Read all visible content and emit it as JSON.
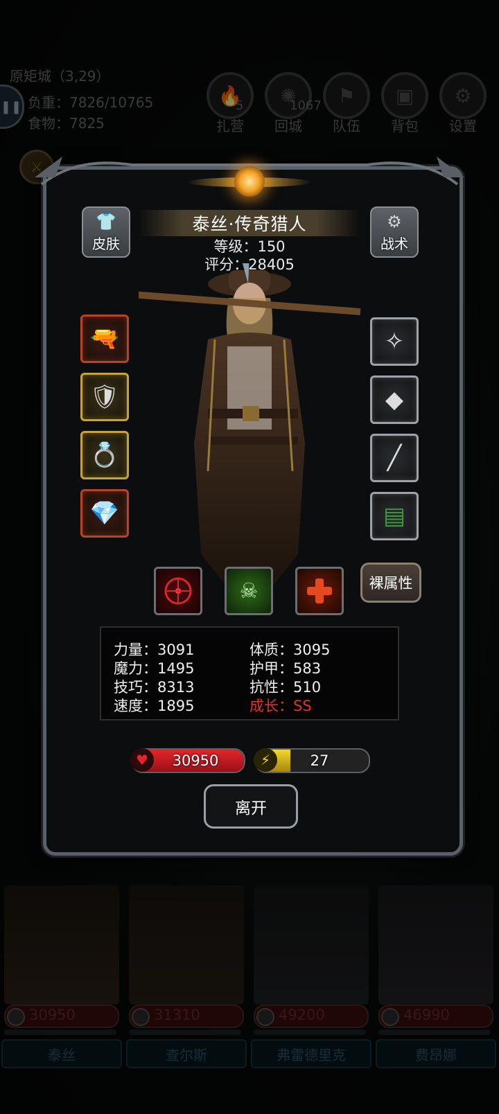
{
  "hud": {
    "location": "原矩城（3,29）",
    "weight": "负重：7826/10765",
    "food": "食物：7825",
    "buttons": [
      {
        "label": "扎营",
        "icon": "campfire-icon",
        "badge": "5"
      },
      {
        "label": "回城",
        "icon": "portal-icon",
        "badge": "1067"
      },
      {
        "label": "队伍",
        "icon": "team-icon"
      },
      {
        "label": "背包",
        "icon": "backpack-icon"
      },
      {
        "label": "设置",
        "icon": "gear-icon"
      }
    ]
  },
  "hero": {
    "name": "泰丝·传奇猎人",
    "level": "等级：150",
    "score": "评分：28405",
    "skin_label": "皮肤",
    "tactics_label": "战术",
    "bare_attr_label": "裸属性",
    "left_slots": [
      {
        "icon": "pistol-icon",
        "frame": "red"
      },
      {
        "icon": "armor-icon",
        "frame": "gold"
      },
      {
        "icon": "ring-icon",
        "frame": "gold"
      },
      {
        "icon": "gem-icon",
        "frame": "red"
      }
    ],
    "right_slots": [
      {
        "icon": "amulet-icon",
        "frame": "grey"
      },
      {
        "icon": "ore-icon",
        "frame": "grey"
      },
      {
        "icon": "bone-icon",
        "frame": "grey"
      },
      {
        "icon": "card-icon",
        "frame": "grey"
      }
    ],
    "skills": [
      {
        "icon": "target-skill-icon",
        "color": "#d8262b"
      },
      {
        "icon": "poison-skill-icon",
        "color": "#5fbf3a"
      },
      {
        "icon": "heal-skill-icon",
        "color": "#e54a1f"
      }
    ],
    "stats": {
      "strength": "力量：3091",
      "constitution": "体质：3095",
      "magic": "魔力：1495",
      "armor": "护甲：583",
      "skill": "技巧：8313",
      "resistance": "抗性：510",
      "speed": "速度：1895",
      "growth": "成长：SS"
    },
    "hp": "30950",
    "energy": "27",
    "energy_fraction": 0.3,
    "leave_label": "离开"
  },
  "team": [
    {
      "name": "泰丝",
      "hp": "30950"
    },
    {
      "name": "查尔斯",
      "hp": "31310"
    },
    {
      "name": "弗雷德里克",
      "hp": "49200"
    },
    {
      "name": "费昂娜",
      "hp": "46990"
    }
  ],
  "colors": {
    "hp_red": "#d41f26",
    "energy_yellow": "#e8c21c",
    "growth_red": "#e5322a"
  }
}
